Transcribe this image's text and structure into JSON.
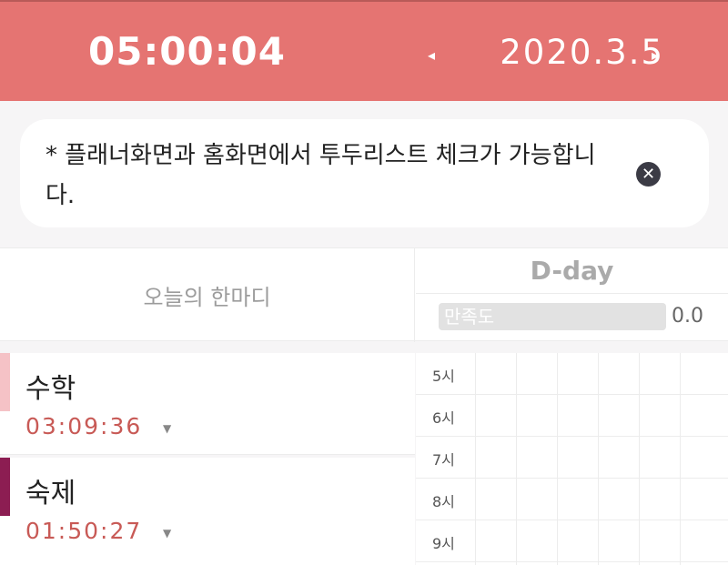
{
  "header": {
    "timer": "05:00:04",
    "date": "2020.3.5",
    "prev_arrow": "◂",
    "next_arrow": "▸"
  },
  "notice": {
    "text": "* 플래너화면과 홈화면에서 투두리스트 체크가 가능합니다.",
    "close": "✕"
  },
  "motto": {
    "label": "오늘의 한마디"
  },
  "dday": {
    "label": "D-day",
    "satisfaction_label": "만족도",
    "satisfaction_value": "0.0"
  },
  "subjects": [
    {
      "name": "수학",
      "time": "03:09:36",
      "color": "#f5c2c6"
    },
    {
      "name": "숙제",
      "time": "01:50:27",
      "color": "#8c1d52"
    }
  ],
  "schedule": {
    "hours": [
      "5시",
      "6시",
      "7시",
      "8시",
      "9시"
    ]
  },
  "colors": {
    "header_bg": "#e57472",
    "timer_text": "#c85a56"
  }
}
